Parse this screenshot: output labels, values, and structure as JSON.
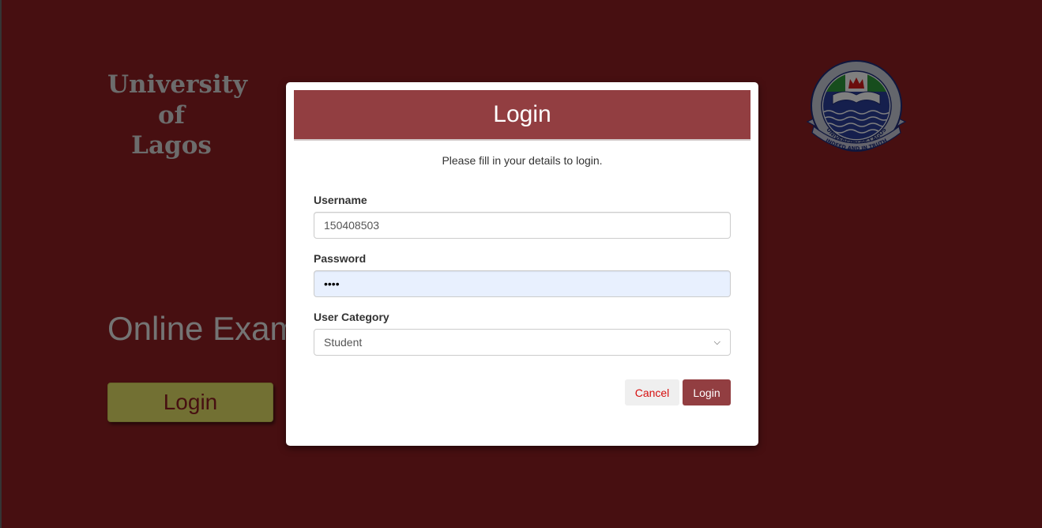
{
  "background": {
    "university_lines": [
      "University",
      "of",
      "Lagos"
    ],
    "headline": "Online Exam",
    "login_button_label": "Login",
    "logo": {
      "icon": "university-of-lagos-crest",
      "ring_text": "UNIVERSITY OF LAGOS",
      "motto": "INDEED AND IN TRUTH"
    }
  },
  "modal": {
    "title": "Login",
    "subtitle": "Please fill in your details to login.",
    "username": {
      "label": "Username",
      "value": "150408503"
    },
    "password": {
      "label": "Password",
      "value": "••••"
    },
    "user_category": {
      "label": "User Category",
      "selected": "Student"
    },
    "cancel_label": "Cancel",
    "login_label": "Login"
  },
  "colors": {
    "page_background": "#8f1f22",
    "modal_header": "#923e41",
    "background_button": "#e4e066",
    "cancel_text": "#d60f0f"
  }
}
